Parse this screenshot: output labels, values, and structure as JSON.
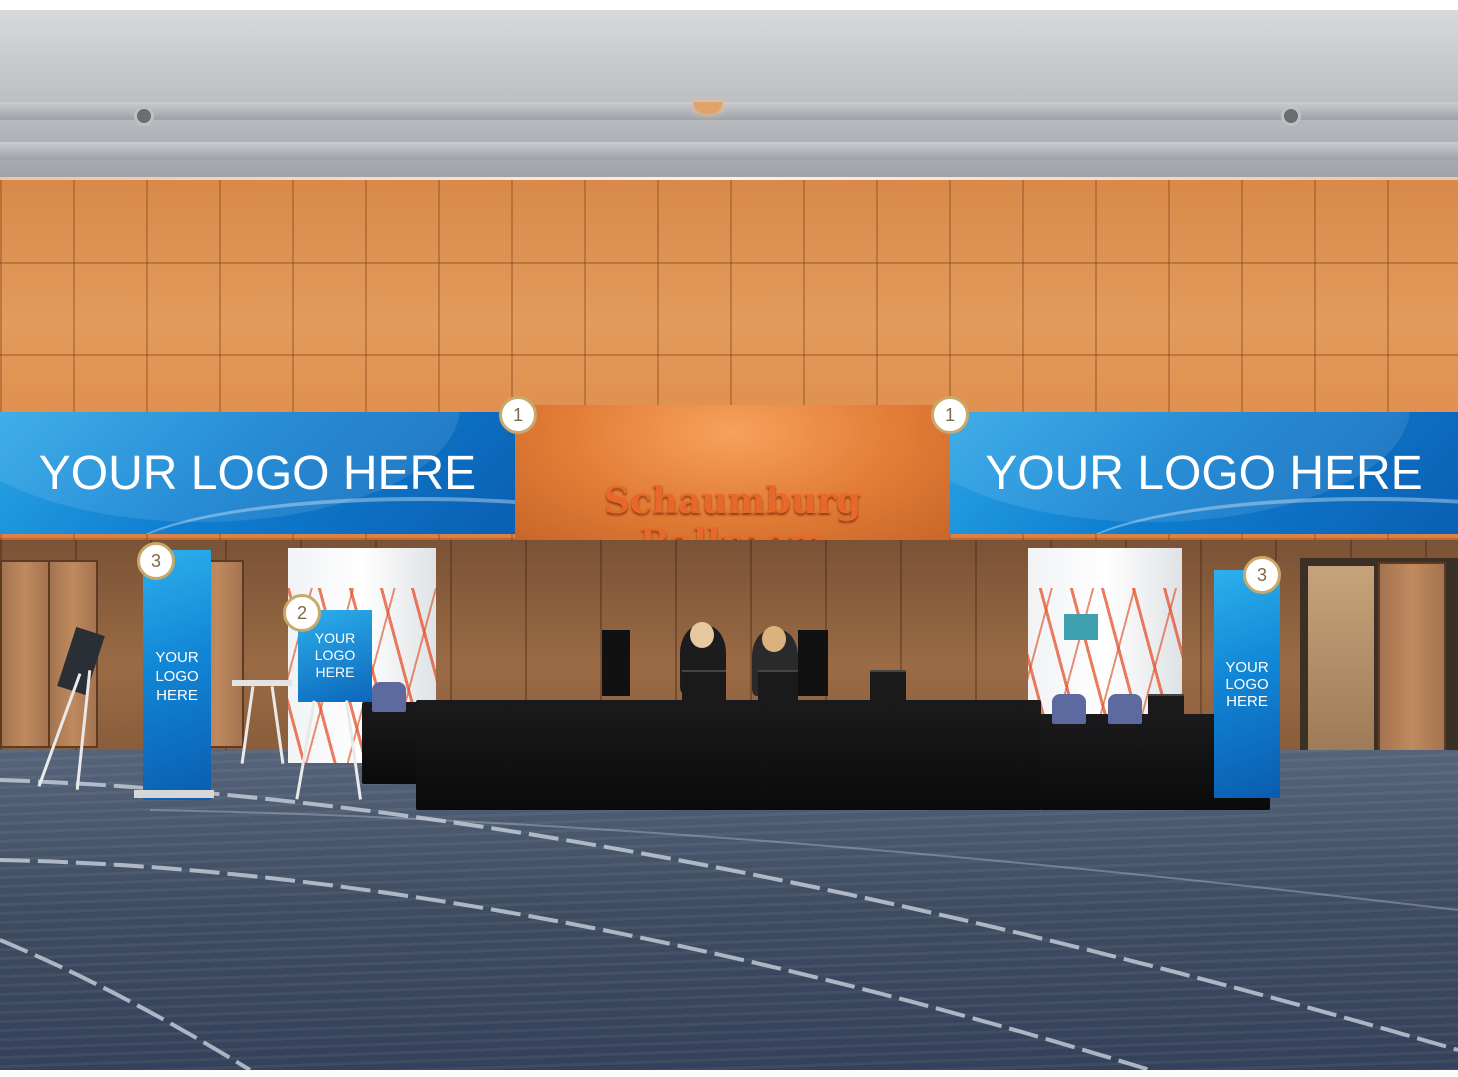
{
  "banners": {
    "left_text": "YOUR LOGO HERE",
    "right_text": "YOUR LOGO HERE",
    "color": "#1180d2"
  },
  "room_sign": {
    "text": "Schaumburg Ballroom",
    "color": "#e8672a"
  },
  "badges": [
    "1",
    "1",
    "2",
    "3",
    "3"
  ],
  "stand_banners": {
    "left": [
      "YOUR",
      "LOGO",
      "HERE"
    ],
    "right": [
      "YOUR",
      "LOGO",
      "HERE"
    ]
  },
  "easel_sign": [
    "YOUR",
    "LOGO",
    "HERE"
  ],
  "badge_border_color": "#c9a86a"
}
